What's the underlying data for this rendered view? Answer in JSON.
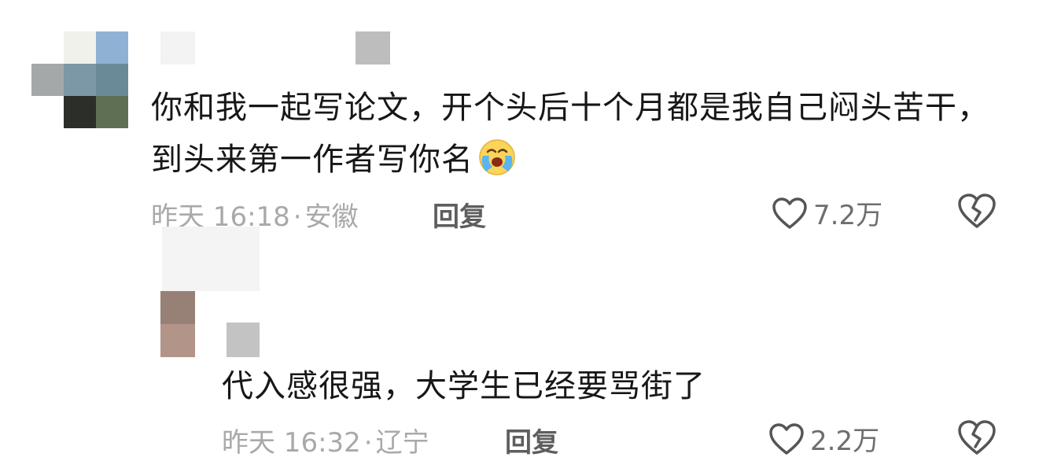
{
  "comments": [
    {
      "text": "你和我一起写论文，开个头后十个月都是我自己闷头苦干，到头来第一作者写你名",
      "emoji": "crying-laugh-emoji",
      "time": "昨天 16:18",
      "location": "安徽",
      "reply_label": "回复",
      "likes": "7.2万"
    },
    {
      "text": "代入感很强，大学生已经要骂街了",
      "time": "昨天 16:32",
      "location": "辽宁",
      "reply_label": "回复",
      "likes": "2.2万"
    }
  ],
  "icons": {
    "like": "heart-outline-icon",
    "dislike": "broken-heart-icon"
  },
  "colors": {
    "meta_text": "#a9a9a9",
    "reply_text": "#5e5e5e",
    "icon_stroke": "#555555",
    "emoji_face": "#fbd45a"
  }
}
